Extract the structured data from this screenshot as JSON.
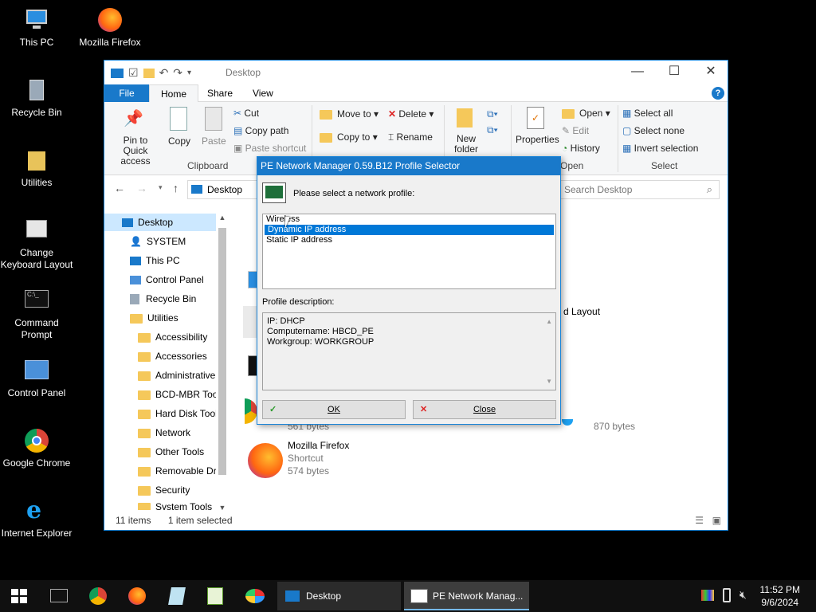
{
  "desktop": {
    "icons": [
      {
        "label": "This PC"
      },
      {
        "label": "Mozilla Firefox"
      },
      {
        "label": "Recycle Bin"
      },
      {
        "label": "Utilities"
      },
      {
        "label": "Change Keyboard Layout"
      },
      {
        "label": "Command Prompt"
      },
      {
        "label": "Control Panel"
      },
      {
        "label": "Google Chrome"
      },
      {
        "label": "Internet Explorer"
      }
    ]
  },
  "explorer": {
    "title": "Desktop",
    "tabs": {
      "file": "File",
      "home": "Home",
      "share": "Share",
      "view": "View"
    },
    "ribbon": {
      "pin": "Pin to Quick access",
      "copy": "Copy",
      "paste": "Paste",
      "cut": "Cut",
      "copy_path": "Copy path",
      "paste_shortcut": "Paste shortcut",
      "clipboard": "Clipboard",
      "move_to": "Move to",
      "copy_to": "Copy to",
      "delete": "Delete",
      "rename": "Rename",
      "new_folder": "New folder",
      "properties": "Properties",
      "open": "Open",
      "edit": "Edit",
      "history": "History",
      "open_group": "Open",
      "select_all": "Select all",
      "select_none": "Select none",
      "invert_selection": "Invert selection",
      "select_group": "Select"
    },
    "address": {
      "location": "Desktop",
      "search_placeholder": "Search Desktop"
    },
    "nav": {
      "items": [
        "Desktop",
        "SYSTEM",
        "This PC",
        "Control Panel",
        "Recycle Bin",
        "Utilities",
        "Accessibility",
        "Accessories",
        "Administrative",
        "BCD-MBR Tool",
        "Hard Disk Tools",
        "Network",
        "Other Tools",
        "Removable Dri",
        "Security",
        "System Tools"
      ]
    },
    "content": {
      "partial_label": "d Layout",
      "size_a": "561 bytes",
      "size_b": "870 bytes",
      "firefox_name": "Mozilla Firefox",
      "firefox_type": "Shortcut",
      "firefox_size": "574 bytes"
    },
    "status": {
      "items": "11 items",
      "selected": "1 item selected"
    }
  },
  "dialog": {
    "title": "PE Network Manager 0.59.B12 Profile Selector",
    "prompt": "Please select a network profile:",
    "profiles": [
      "Wireless",
      "Dynamic IP address",
      "Static IP address"
    ],
    "selected_profile": "Dynamic IP address",
    "desc_label": "Profile description:",
    "desc_lines": [
      "IP: DHCP",
      "Computername: HBCD_PE",
      "Workgroup: WORKGROUP"
    ],
    "ok": "OK",
    "close": "Close"
  },
  "taskbar": {
    "tasks": [
      {
        "label": "Desktop"
      },
      {
        "label": "PE Network Manag..."
      }
    ],
    "time": "11:52 PM",
    "date": "9/6/2024"
  }
}
